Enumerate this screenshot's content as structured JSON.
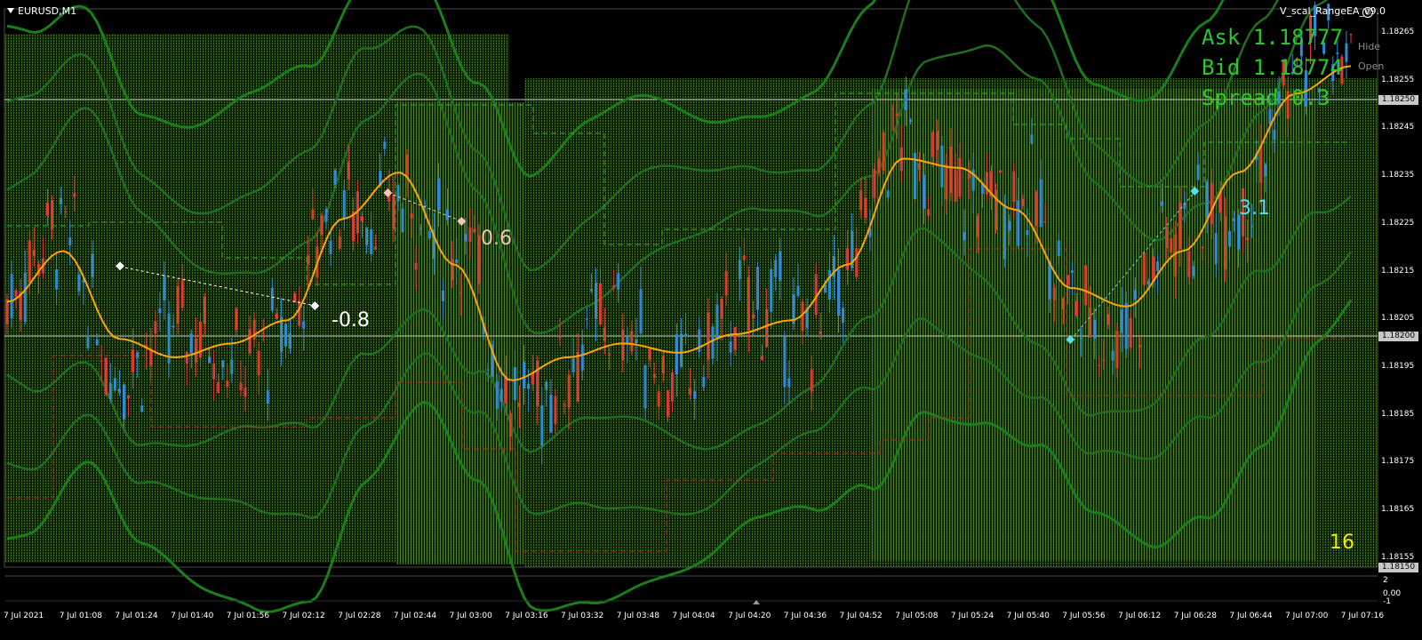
{
  "chart": {
    "symbol": "EURUSD,M1",
    "ea_name": "V_scal_RangeEA_v9.0",
    "ask_text": "Ask 1.18777",
    "bid_text": "Bid 1.18774",
    "spread_text": "Spread 0.3",
    "hide_button": "Hide",
    "open_button": "Open",
    "price_axis": [
      "1.18265",
      "1.18255",
      "1.18245",
      "1.18235",
      "1.18225",
      "1.18215",
      "1.18205",
      "1.18195",
      "1.18185",
      "1.18175",
      "1.18165",
      "1.18155"
    ],
    "price_tags": [
      "1.18250",
      "1.18200",
      "1.18150"
    ],
    "subwindow_axis": [
      "2",
      "0.00",
      "-1"
    ],
    "time_axis": [
      "7 Jul 2021",
      "7 Jul 01:08",
      "7 Jul 01:24",
      "7 Jul 01:40",
      "7 Jul 01:56",
      "7 Jul 02:12",
      "7 Jul 02:28",
      "7 Jul 02:44",
      "7 Jul 03:00",
      "7 Jul 03:16",
      "7 Jul 03:32",
      "7 Jul 03:48",
      "7 Jul 04:04",
      "7 Jul 04:20",
      "7 Jul 04:36",
      "7 Jul 04:52",
      "7 Jul 05:08",
      "7 Jul 05:24",
      "7 Jul 05:40",
      "7 Jul 05:56",
      "7 Jul 06:12",
      "7 Jul 06:28",
      "7 Jul 06:44",
      "7 Jul 07:00",
      "7 Jul 07:16"
    ],
    "annotations": [
      "-0.8",
      "0.6",
      "3.1",
      "16"
    ]
  },
  "colors": {
    "background": "#000000",
    "bull_candle": "#2e8bd8",
    "bear_candle": "#e03c2c",
    "moving_average": "#ffa500",
    "band": "#1c8c1c",
    "grid_fill": "#2c5a10",
    "level_line": "#c8c8c8"
  },
  "chart_data": {
    "type": "line",
    "title": "EURUSD,M1",
    "x_labels": [
      "7 Jul 2021",
      "7 Jul 01:08",
      "7 Jul 01:24",
      "7 Jul 01:40",
      "7 Jul 01:56",
      "7 Jul 02:12",
      "7 Jul 02:28",
      "7 Jul 02:44",
      "7 Jul 03:00",
      "7 Jul 03:16",
      "7 Jul 03:32",
      "7 Jul 03:48",
      "7 Jul 04:04",
      "7 Jul 04:20",
      "7 Jul 04:36",
      "7 Jul 04:52",
      "7 Jul 05:08",
      "7 Jul 05:24",
      "7 Jul 05:40",
      "7 Jul 05:56",
      "7 Jul 06:12",
      "7 Jul 06:28",
      "7 Jul 06:44",
      "7 Jul 07:00",
      "7 Jul 07:16"
    ],
    "ylim": [
      1.1815,
      1.1827
    ],
    "series": [
      {
        "values": [
          1.18207,
          1.18218,
          1.18199,
          1.18195,
          1.18198,
          1.18203,
          1.18225,
          1.18235,
          1.18215,
          1.1819,
          1.18195,
          1.18198,
          1.18196,
          1.182,
          1.18203,
          1.18215,
          1.18238,
          1.18236,
          1.18227,
          1.1821,
          1.18206,
          1.18218,
          1.18235,
          1.18252,
          1.18258
        ]
      }
    ]
  }
}
